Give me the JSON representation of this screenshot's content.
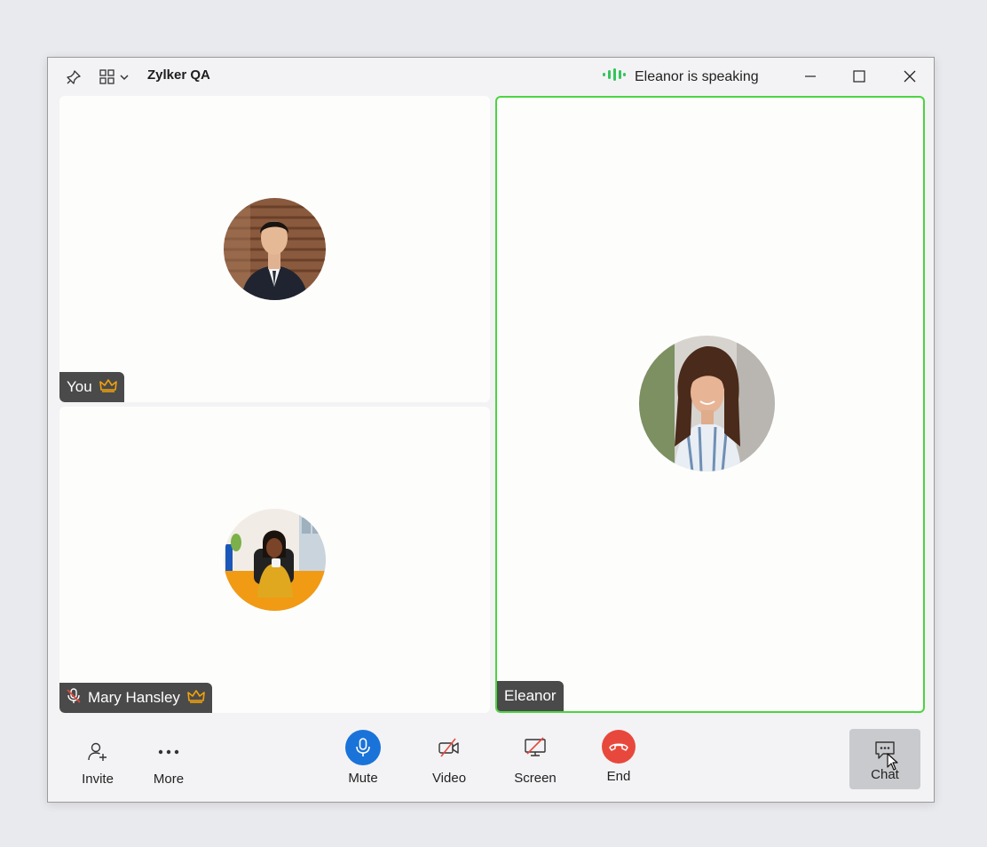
{
  "window": {
    "title": "Zylker QA",
    "speaking_text": "Eleanor is speaking"
  },
  "participants": {
    "you": {
      "label": "You",
      "role_icon": "crown-icon"
    },
    "mary": {
      "label": "Mary Hansley",
      "role_icon": "crown-icon",
      "muted": true
    },
    "eleanor": {
      "label": "Eleanor",
      "active_speaker": true
    }
  },
  "toolbar": {
    "invite": "Invite",
    "more": "More",
    "mute": "Mute",
    "video": "Video",
    "screen": "Screen",
    "end": "End",
    "chat": "Chat"
  },
  "colors": {
    "active_border": "#4cd440",
    "mute_button": "#1a73d9",
    "end_button": "#e8483c",
    "crown": "#f0a20c",
    "speaking_indicator": "#35c45c"
  }
}
